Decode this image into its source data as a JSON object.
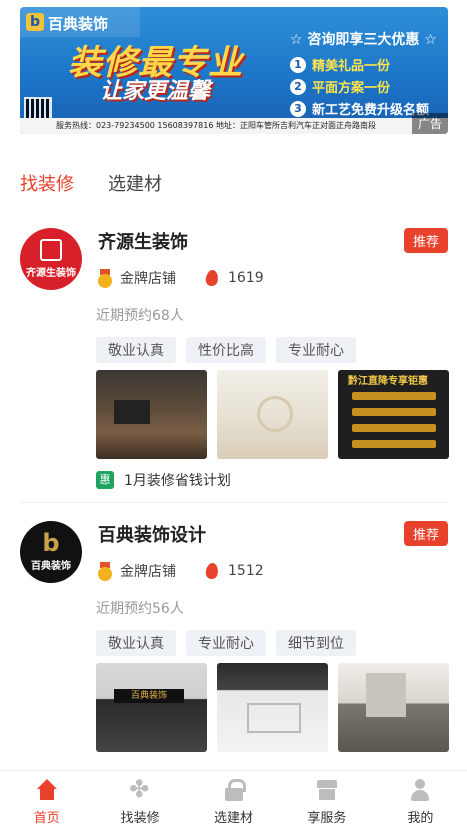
{
  "banner": {
    "brand": "百典装饰",
    "headline": "装修最专业",
    "headline2": "让家更温馨",
    "offer_title": "☆ 咨询即享三大优惠 ☆",
    "offers": [
      {
        "num": "1",
        "text": "精美礼品一份"
      },
      {
        "num": "2",
        "text": "平面方案一份"
      },
      {
        "num": "3",
        "text": "新工艺免费升级名额"
      }
    ],
    "footer": "服务热线：023-79234500  15608397816  地址：正阳车管所吉利汽车正对面正舟路南段",
    "ad_label": "广告"
  },
  "tabs": [
    {
      "label": "找装修",
      "active": true
    },
    {
      "label": "选建材",
      "active": false
    }
  ],
  "stores": [
    {
      "name": "齐源生装饰",
      "avatar_text": "齐源生装饰",
      "badge": "推荐",
      "level": "金牌店铺",
      "heat": "1619",
      "recent": "近期预约68人",
      "tags": [
        "敬业认真",
        "性价比高",
        "专业耐心"
      ],
      "photo3_caption": "黔江直降专享钜惠",
      "promo_badge": "惠",
      "promo": "1月装修省钱计划"
    },
    {
      "name": "百典装饰设计",
      "avatar_text": "百典装饰",
      "badge": "推荐",
      "level": "金牌店铺",
      "heat": "1512",
      "recent": "近期预约56人",
      "tags": [
        "敬业认真",
        "专业耐心",
        "细节到位"
      ],
      "photo1_caption": "百典装饰"
    }
  ],
  "bottom_nav": [
    {
      "label": "首页",
      "icon": "home-icon",
      "active": true
    },
    {
      "label": "找装修",
      "icon": "clover-icon",
      "active": false
    },
    {
      "label": "选建材",
      "icon": "lock-icon",
      "active": false
    },
    {
      "label": "享服务",
      "icon": "shop-icon",
      "active": false
    },
    {
      "label": "我的",
      "icon": "user-icon",
      "active": false
    }
  ],
  "colors": {
    "accent": "#e8412c",
    "tag_bg": "#eef1f6",
    "promo_green": "#20a35f"
  }
}
